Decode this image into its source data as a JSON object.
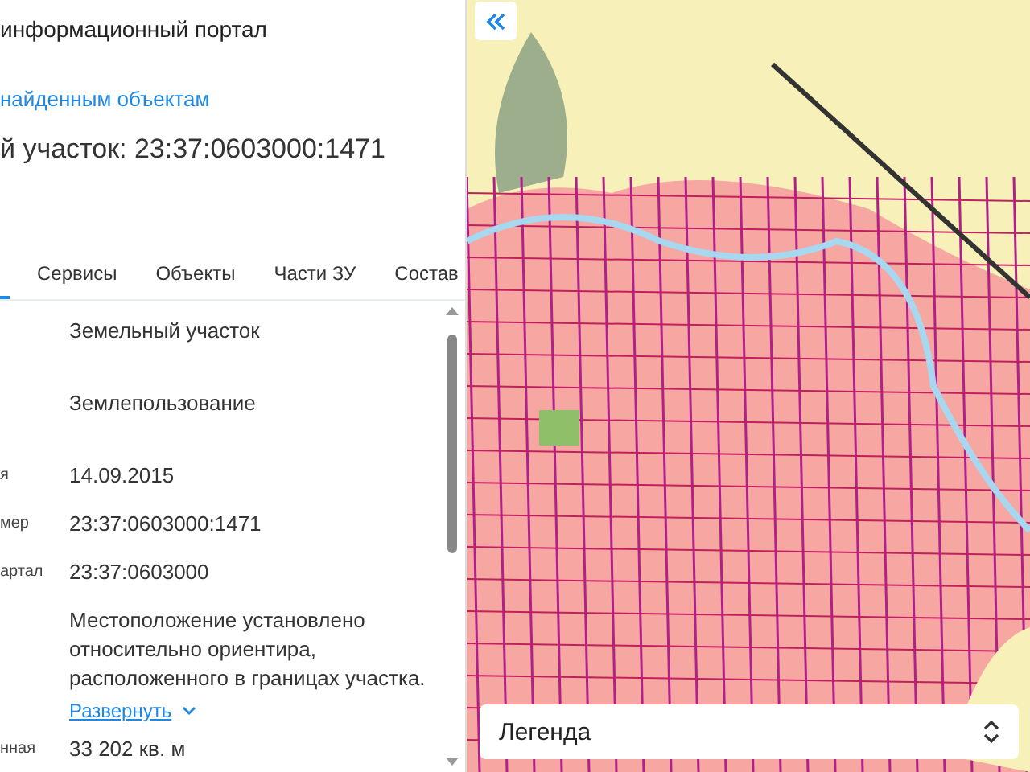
{
  "header": {
    "title": "информационный портал",
    "back_link": "найденным объектам",
    "heading": "й участок: 23:37:0603000:1471"
  },
  "tabs": [
    {
      "selected": true
    },
    {
      "label": "Сервисы",
      "selected": false
    },
    {
      "label": "Объекты",
      "selected": false
    },
    {
      "label": "Части ЗУ",
      "selected": false
    },
    {
      "label": "Состав",
      "selected": false
    }
  ],
  "fields": [
    {
      "value": "Земельный участок"
    },
    {
      "value": "Землепользование"
    },
    {
      "label": "я",
      "value": "14.09.2015"
    },
    {
      "label": "мер",
      "value": "23:37:0603000:1471"
    },
    {
      "label": "артал",
      "value": "23:37:0603000"
    },
    {
      "value": "Местоположение установлено относительно ориентира, расположенного в границах участка.",
      "expand_link": "Развернуть"
    },
    {
      "label": "нная",
      "value": "33 202 кв. м"
    }
  ],
  "map": {
    "legend": {
      "title": "Легенда"
    }
  }
}
